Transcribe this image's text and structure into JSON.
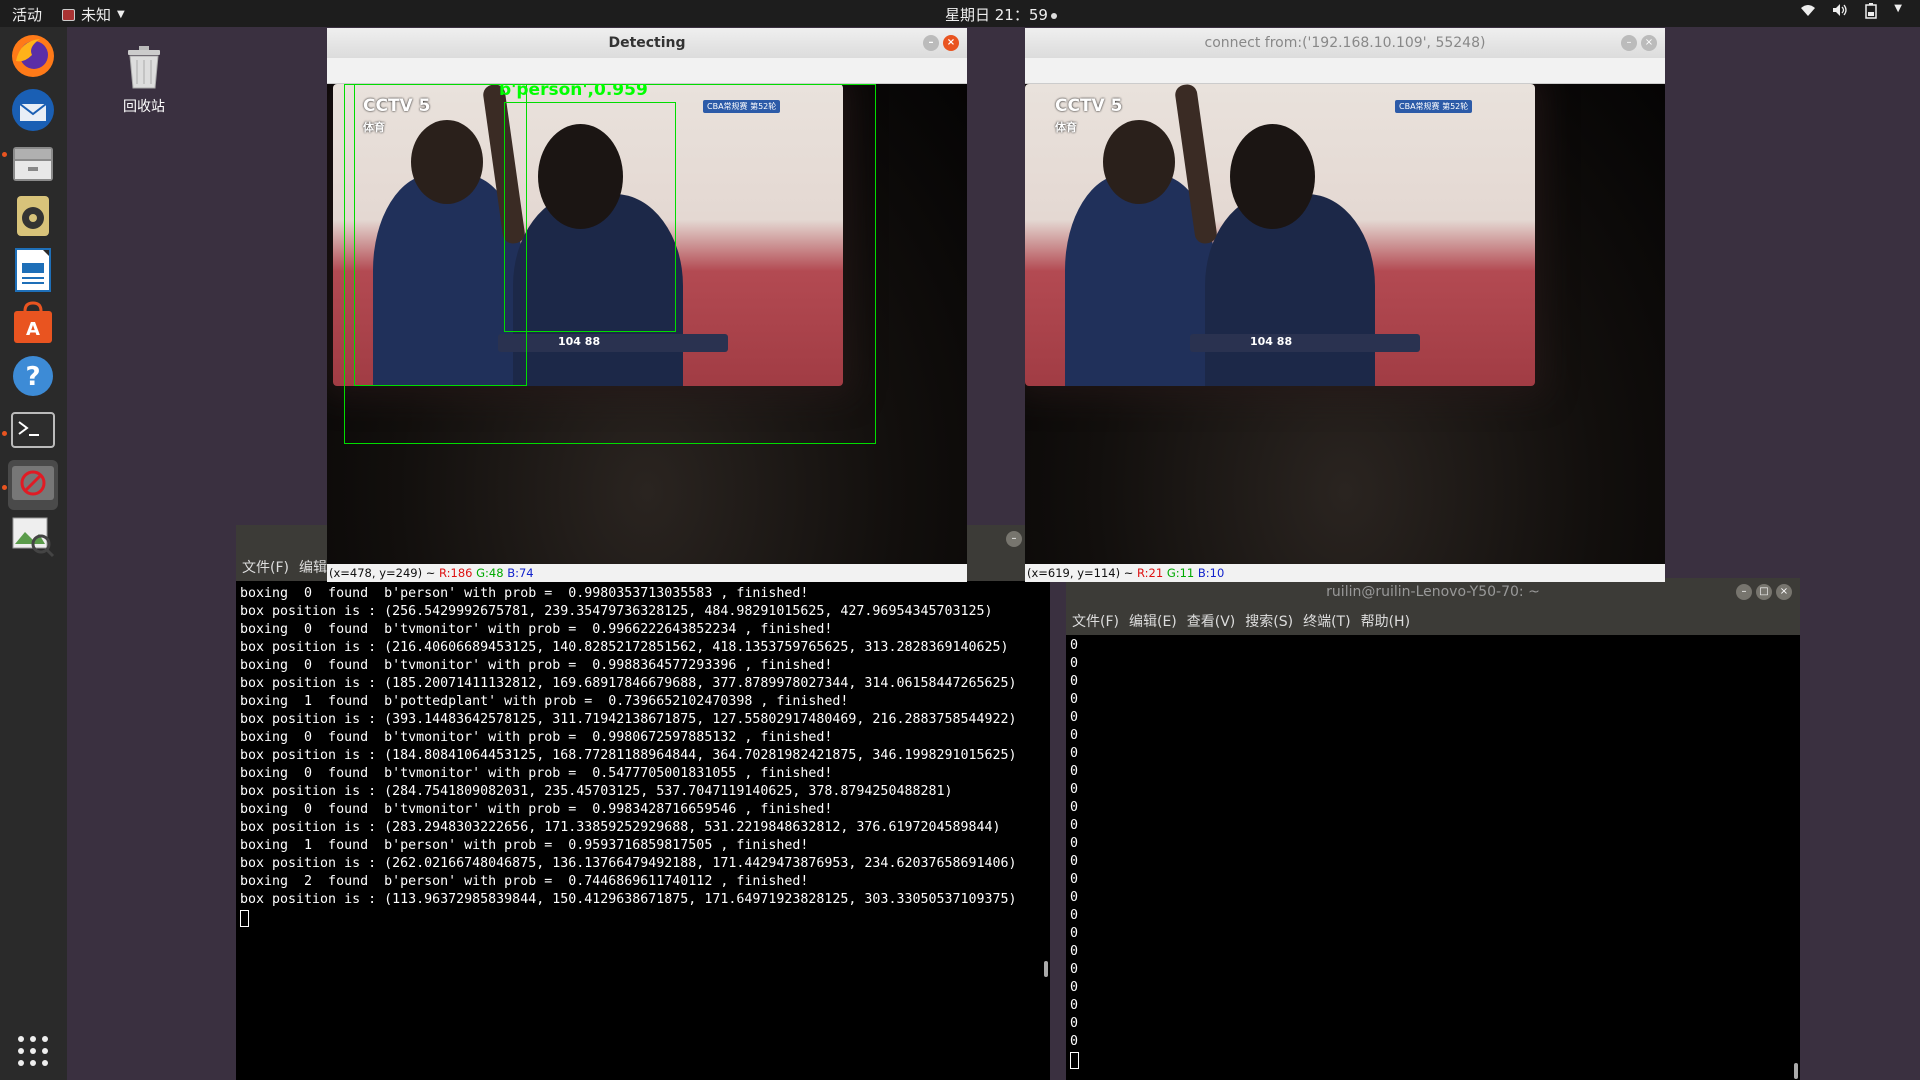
{
  "topbar": {
    "activities": "活动",
    "app_name": "未知",
    "clock": "星期日 21：59",
    "tray_icons": [
      "wifi-icon",
      "volume-icon",
      "battery-icon",
      "power-menu-icon"
    ]
  },
  "desktop": {
    "trash_label": "回收站"
  },
  "dock": {
    "items": [
      "firefox-icon",
      "thunderbird-icon",
      "files-icon",
      "rhythmbox-icon",
      "libreoffice-writer-icon",
      "software-center-icon",
      "help-icon",
      "terminal-icon",
      "image-viewer-icon",
      "image-app-icon"
    ],
    "show_apps_icon": "show-apps-grid-icon"
  },
  "detect_window": {
    "title": "Detecting",
    "bbox_label": "b'person',0.959",
    "tv_logo": "CCTV 5",
    "tv_logo_sub": "体育",
    "broadcast_tag": "CBA常规赛 第52轮",
    "score": "104 88",
    "status": {
      "coords": "(x=478, y=249) ~ ",
      "r": "R:186",
      "g": "G:48",
      "b": "B:74"
    }
  },
  "connect_window": {
    "title": "connect from:('192.168.10.109', 55248)",
    "tv_logo": "CCTV 5",
    "tv_logo_sub": "体育",
    "broadcast_tag": "CBA常规赛 第52轮",
    "score": "104 88",
    "status": {
      "coords": "(x=619, y=114) ~ ",
      "r": "R:21",
      "g": "G:11",
      "b": "B:10"
    }
  },
  "left_terminal": {
    "menu": [
      "文件(F)",
      "编辑"
    ],
    "lines": [
      "boxing  0  found  b'person' with prob =  0.9980353713035583 , finished!",
      "box position is : (256.5429992675781, 239.35479736328125, 484.98291015625, 427.96954345703125)",
      "boxing  0  found  b'tvmonitor' with prob =  0.9966222643852234 , finished!",
      "box position is : (216.40606689453125, 140.82852172851562, 418.1353759765625, 313.2828369140625)",
      "boxing  0  found  b'tvmonitor' with prob =  0.9988364577293396 , finished!",
      "box position is : (185.20071411132812, 169.68917846679688, 377.8789978027344, 314.06158447265625)",
      "boxing  1  found  b'pottedplant' with prob =  0.7396652102470398 , finished!",
      "box position is : (393.14483642578125, 311.71942138671875, 127.55802917480469, 216.2883758544922)",
      "boxing  0  found  b'tvmonitor' with prob =  0.9980672597885132 , finished!",
      "box position is : (184.80841064453125, 168.77281188964844, 364.70281982421875, 346.1998291015625)",
      "boxing  0  found  b'tvmonitor' with prob =  0.5477705001831055 , finished!",
      "box position is : (284.7541809082031, 235.45703125, 537.7047119140625, 378.8794250488281)",
      "boxing  0  found  b'tvmonitor' with prob =  0.9983428716659546 , finished!",
      "box position is : (283.2948303222656, 171.33859252929688, 531.2219848632812, 376.6197204589844)",
      "boxing  1  found  b'person' with prob =  0.9593716859817505 , finished!",
      "box position is : (262.02166748046875, 136.13766479492188, 171.4429473876953, 234.62037658691406)",
      "boxing  2  found  b'person' with prob =  0.7446869611740112 , finished!",
      "box position is : (113.96372985839844, 150.4129638671875, 171.64971923828125, 303.33050537109375)"
    ]
  },
  "right_terminal": {
    "title": "ruilin@ruilin-Lenovo-Y50-70: ~",
    "menu": [
      "文件(F)",
      "编辑(E)",
      "查看(V)",
      "搜索(S)",
      "终端(T)",
      "帮助(H)"
    ],
    "zero_lines": [
      "0",
      "0",
      "0",
      "0",
      "0",
      "0",
      "0",
      "0",
      "0",
      "0",
      "0",
      "0",
      "0",
      "0",
      "0",
      "0",
      "0",
      "0",
      "0",
      "0",
      "0",
      "0",
      "0"
    ]
  }
}
